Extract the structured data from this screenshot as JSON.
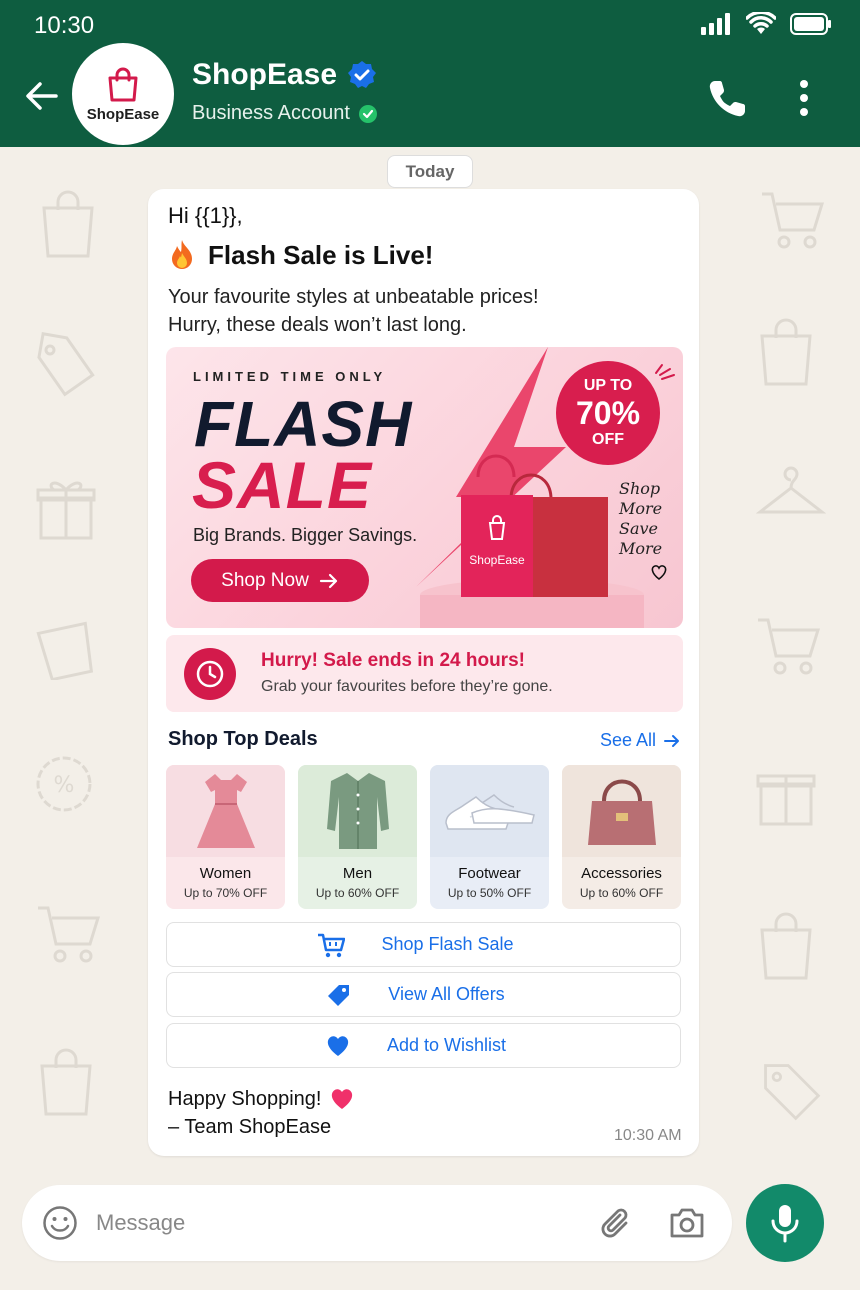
{
  "status_bar": {
    "time": "10:30"
  },
  "header": {
    "avatar_name": "ShopEase",
    "name": "ShopEase",
    "subtitle": "Business Account",
    "brand_color": "#0e5d40"
  },
  "chat": {
    "date_chip": "Today",
    "message": {
      "greeting": "Hi {{1}},",
      "headline_icon": "fire-emoji",
      "headline": "Flash Sale is Live!",
      "intro_line1": "Your favourite styles at unbeatable prices!",
      "intro_line2": "Hurry, these deals won’t last long.",
      "banner": {
        "limited": "LIMITED TIME ONLY",
        "flash": "FLASH",
        "sale": "SALE",
        "tagline": "Big Brands. Bigger Savings.",
        "cta": "Shop Now",
        "badge_top": "UP TO",
        "badge_percent": "70%",
        "badge_bottom": "OFF",
        "bag_label": "ShopEase",
        "script_1": "Shop",
        "script_2": "More",
        "script_3": "Save",
        "script_4": "More"
      },
      "hurry": {
        "title": "Hurry! Sale ends in 24 hours!",
        "subtitle": "Grab your favourites before they’re gone."
      },
      "deals": {
        "title": "Shop Top Deals",
        "see_all": "See All",
        "cards": [
          {
            "name": "Women",
            "offer": "Up to 70% OFF"
          },
          {
            "name": "Men",
            "offer": "Up to 60% OFF"
          },
          {
            "name": "Footwear",
            "offer": "Up to 50% OFF"
          },
          {
            "name": "Accessories",
            "offer": "Up to 60% OFF"
          }
        ]
      },
      "actions": [
        {
          "label": "Shop Flash Sale",
          "icon": "cart-icon"
        },
        {
          "label": "View All Offers",
          "icon": "tag-icon"
        },
        {
          "label": "Add to Wishlist",
          "icon": "heart-icon"
        }
      ],
      "signoff_line1": "Happy Shopping!",
      "signoff_line2": "– Team ShopEase",
      "time": "10:30 AM"
    }
  },
  "input": {
    "placeholder": "Message"
  },
  "colors": {
    "accent_pink": "#d31a4b",
    "link_blue": "#1a6fe8",
    "wallpaper": "#f3efe8"
  }
}
